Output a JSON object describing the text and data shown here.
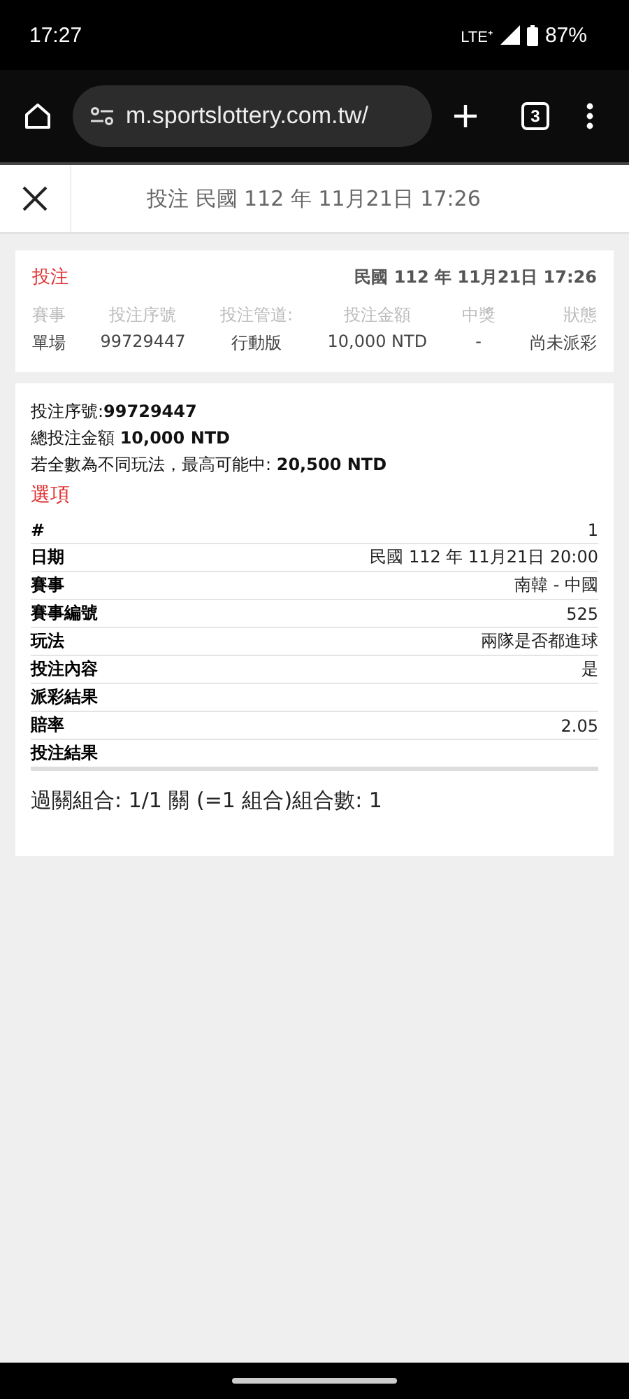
{
  "status_bar": {
    "time": "17:27",
    "network": "LTE⁺",
    "battery": "87%"
  },
  "browser": {
    "url": "m.sportslottery.com.tw/",
    "tab_count": "3"
  },
  "header": {
    "title": "投注 民國 112 年 11月21日 17:26"
  },
  "bet_card": {
    "label": "投注",
    "date": "民國 112 年 11月21日 17:26",
    "columns": [
      {
        "heading": "賽事",
        "value": "單場"
      },
      {
        "heading": "投注序號",
        "value": "99729447"
      },
      {
        "heading": "投注管道:",
        "value": "行動版"
      },
      {
        "heading": "投注金額",
        "value": "10,000 NTD"
      },
      {
        "heading": "中獎",
        "value": "-"
      },
      {
        "heading": "狀態",
        "value": "尚未派彩"
      }
    ]
  },
  "detail": {
    "lines": [
      "投注序號:**99729447**",
      "總投注金額 **10,000 NTD**",
      "若全數為不同玩法，最高可能中: **20,500 NTD**"
    ],
    "options_heading": "選項",
    "rows": [
      {
        "label": "#",
        "value": "1"
      },
      {
        "label": "日期",
        "value": "民國 112 年 11月21日 20:00"
      },
      {
        "label": "賽事",
        "value": "南韓 - 中國"
      },
      {
        "label": "賽事編號",
        "value": "525"
      },
      {
        "label": "玩法",
        "value": "兩隊是否都進球"
      },
      {
        "label": "投注內容",
        "value": "是"
      },
      {
        "label": "派彩結果",
        "value": ""
      },
      {
        "label": "賠率",
        "value": "2.05"
      },
      {
        "label": "投注結果",
        "value": ""
      }
    ],
    "combination": "過關組合: 1/1 關 (=1 組合)組合數: 1"
  }
}
